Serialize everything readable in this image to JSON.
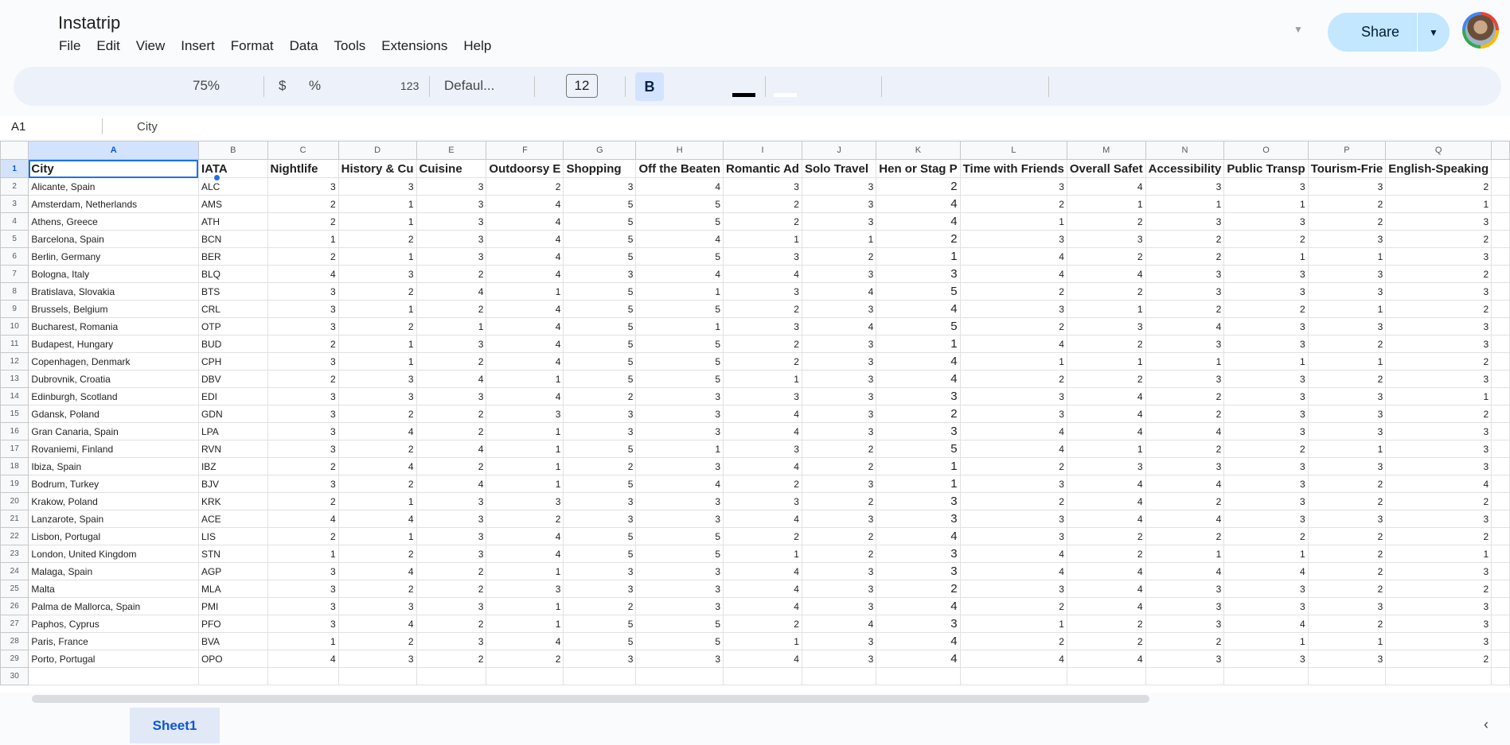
{
  "app": {
    "title": "Instatrip",
    "menu": [
      "File",
      "Edit",
      "View",
      "Insert",
      "Format",
      "Data",
      "Tools",
      "Extensions",
      "Help"
    ],
    "share_label": "Share"
  },
  "toolbar": {
    "zoom": "75%",
    "currency": "$",
    "percent": "%",
    "more_formats": "123",
    "font": "Defaul...",
    "font_size": "12",
    "bold": "B"
  },
  "formula_bar": {
    "cell_ref": "A1",
    "value": "City"
  },
  "sheet": {
    "columns": [
      "A",
      "B",
      "C",
      "D",
      "E",
      "F",
      "G",
      "H",
      "I",
      "J",
      "K",
      "L",
      "M",
      "N",
      "O",
      "P",
      "Q"
    ],
    "header": [
      "City",
      "IATA",
      "Nightlife",
      "History & Cu",
      "Cuisine",
      "Outdoorsy E",
      "Shopping",
      "Off the Beaten",
      "Romantic Ad",
      "Solo Travel",
      "Hen or Stag P",
      "Time with Friends",
      "Overall Safet",
      "Accessibility",
      "Public Transp",
      "Tourism-Frie",
      "English-Speaking"
    ],
    "row_numbers": [
      "1",
      "2",
      "3",
      "4",
      "5",
      "6",
      "7",
      "8",
      "9",
      "10",
      "11",
      "12",
      "13",
      "14",
      "15",
      "16",
      "17",
      "18",
      "19",
      "20",
      "21",
      "22",
      "23",
      "24",
      "25",
      "26",
      "27",
      "28",
      "29",
      "30"
    ],
    "rows": [
      [
        "Alicante, Spain",
        "ALC",
        "3",
        "3",
        "3",
        "2",
        "3",
        "4",
        "3",
        "3",
        "2",
        "3",
        "4",
        "3",
        "3",
        "3",
        "2"
      ],
      [
        "Amsterdam, Netherlands",
        "AMS",
        "2",
        "1",
        "3",
        "4",
        "5",
        "5",
        "2",
        "3",
        "4",
        "2",
        "1",
        "1",
        "1",
        "2",
        "1"
      ],
      [
        "Athens, Greece",
        "ATH",
        "2",
        "1",
        "3",
        "4",
        "5",
        "5",
        "2",
        "3",
        "4",
        "1",
        "2",
        "3",
        "3",
        "2",
        "3"
      ],
      [
        "Barcelona, Spain",
        "BCN",
        "1",
        "2",
        "3",
        "4",
        "5",
        "4",
        "1",
        "1",
        "2",
        "3",
        "3",
        "2",
        "2",
        "3",
        "2"
      ],
      [
        "Berlin, Germany",
        "BER",
        "2",
        "1",
        "3",
        "4",
        "5",
        "5",
        "3",
        "2",
        "1",
        "4",
        "2",
        "2",
        "1",
        "1",
        "3"
      ],
      [
        "Bologna, Italy",
        "BLQ",
        "4",
        "3",
        "2",
        "4",
        "3",
        "4",
        "4",
        "3",
        "3",
        "4",
        "4",
        "3",
        "3",
        "3",
        "2"
      ],
      [
        "Bratislava, Slovakia",
        "BTS",
        "3",
        "2",
        "4",
        "1",
        "5",
        "1",
        "3",
        "4",
        "5",
        "2",
        "2",
        "3",
        "3",
        "3",
        "3"
      ],
      [
        "Brussels, Belgium",
        "CRL",
        "3",
        "1",
        "2",
        "4",
        "5",
        "5",
        "2",
        "3",
        "4",
        "3",
        "1",
        "2",
        "2",
        "1",
        "2"
      ],
      [
        "Bucharest, Romania",
        "OTP",
        "3",
        "2",
        "1",
        "4",
        "5",
        "1",
        "3",
        "4",
        "5",
        "2",
        "3",
        "4",
        "3",
        "3",
        "3"
      ],
      [
        "Budapest, Hungary",
        "BUD",
        "2",
        "1",
        "3",
        "4",
        "5",
        "5",
        "2",
        "3",
        "1",
        "4",
        "2",
        "3",
        "3",
        "2",
        "3"
      ],
      [
        "Copenhagen, Denmark",
        "CPH",
        "3",
        "1",
        "2",
        "4",
        "5",
        "5",
        "2",
        "3",
        "4",
        "1",
        "1",
        "1",
        "1",
        "1",
        "2"
      ],
      [
        "Dubrovnik, Croatia",
        "DBV",
        "2",
        "3",
        "4",
        "1",
        "5",
        "5",
        "1",
        "3",
        "4",
        "2",
        "2",
        "3",
        "3",
        "2",
        "3"
      ],
      [
        "Edinburgh, Scotland",
        "EDI",
        "3",
        "3",
        "3",
        "4",
        "2",
        "3",
        "3",
        "3",
        "3",
        "3",
        "4",
        "2",
        "3",
        "3",
        "1"
      ],
      [
        "Gdansk, Poland",
        "GDN",
        "3",
        "2",
        "2",
        "3",
        "3",
        "3",
        "4",
        "3",
        "2",
        "3",
        "4",
        "2",
        "3",
        "3",
        "2"
      ],
      [
        "Gran Canaria, Spain",
        "LPA",
        "3",
        "4",
        "2",
        "1",
        "3",
        "3",
        "4",
        "3",
        "3",
        "4",
        "4",
        "4",
        "3",
        "3",
        "3"
      ],
      [
        "Rovaniemi, Finland",
        "RVN",
        "3",
        "2",
        "4",
        "1",
        "5",
        "1",
        "3",
        "2",
        "5",
        "4",
        "1",
        "2",
        "2",
        "1",
        "3"
      ],
      [
        "Ibiza, Spain",
        "IBZ",
        "2",
        "4",
        "2",
        "1",
        "2",
        "3",
        "4",
        "2",
        "1",
        "2",
        "3",
        "3",
        "3",
        "3",
        "3"
      ],
      [
        "Bodrum, Turkey",
        "BJV",
        "3",
        "2",
        "4",
        "1",
        "5",
        "4",
        "2",
        "3",
        "1",
        "3",
        "4",
        "4",
        "3",
        "2",
        "4"
      ],
      [
        "Krakow, Poland",
        "KRK",
        "2",
        "1",
        "3",
        "3",
        "3",
        "3",
        "3",
        "2",
        "3",
        "2",
        "4",
        "2",
        "3",
        "2",
        "2"
      ],
      [
        "Lanzarote, Spain",
        "ACE",
        "4",
        "4",
        "3",
        "2",
        "3",
        "3",
        "4",
        "3",
        "3",
        "3",
        "4",
        "4",
        "3",
        "3",
        "3"
      ],
      [
        "Lisbon, Portugal",
        "LIS",
        "2",
        "1",
        "3",
        "4",
        "5",
        "5",
        "2",
        "2",
        "4",
        "3",
        "2",
        "2",
        "2",
        "2",
        "2"
      ],
      [
        "London, United Kingdom",
        "STN",
        "1",
        "2",
        "3",
        "4",
        "5",
        "5",
        "1",
        "2",
        "3",
        "4",
        "2",
        "1",
        "1",
        "2",
        "1"
      ],
      [
        "Malaga, Spain",
        "AGP",
        "3",
        "4",
        "2",
        "1",
        "3",
        "3",
        "4",
        "3",
        "3",
        "4",
        "4",
        "4",
        "4",
        "2",
        "3"
      ],
      [
        "Malta",
        "MLA",
        "3",
        "2",
        "2",
        "3",
        "3",
        "3",
        "4",
        "3",
        "2",
        "3",
        "4",
        "3",
        "3",
        "2",
        "2"
      ],
      [
        "Palma de Mallorca, Spain",
        "PMI",
        "3",
        "3",
        "3",
        "1",
        "2",
        "3",
        "4",
        "3",
        "4",
        "2",
        "4",
        "3",
        "3",
        "3",
        "3"
      ],
      [
        "Paphos, Cyprus",
        "PFO",
        "3",
        "4",
        "2",
        "1",
        "5",
        "5",
        "2",
        "4",
        "3",
        "1",
        "2",
        "3",
        "4",
        "2",
        "3"
      ],
      [
        "Paris, France",
        "BVA",
        "1",
        "2",
        "3",
        "4",
        "5",
        "5",
        "1",
        "3",
        "4",
        "2",
        "2",
        "2",
        "1",
        "1",
        "3"
      ],
      [
        "Porto, Portugal",
        "OPO",
        "4",
        "3",
        "2",
        "2",
        "3",
        "3",
        "4",
        "3",
        "4",
        "4",
        "4",
        "3",
        "3",
        "3",
        "2"
      ],
      [
        "",
        "",
        "",
        "",
        "",
        "",
        "",
        "",
        "",
        "",
        "",
        "",
        "",
        "",
        "",
        "",
        ""
      ]
    ]
  },
  "sheets": [
    "Sheet1"
  ],
  "colors": {
    "accent": "#1a73e8",
    "share_bg": "#c2e7ff",
    "toolbar_bg": "#edf2fa",
    "active_tab": "#0b57d0"
  }
}
